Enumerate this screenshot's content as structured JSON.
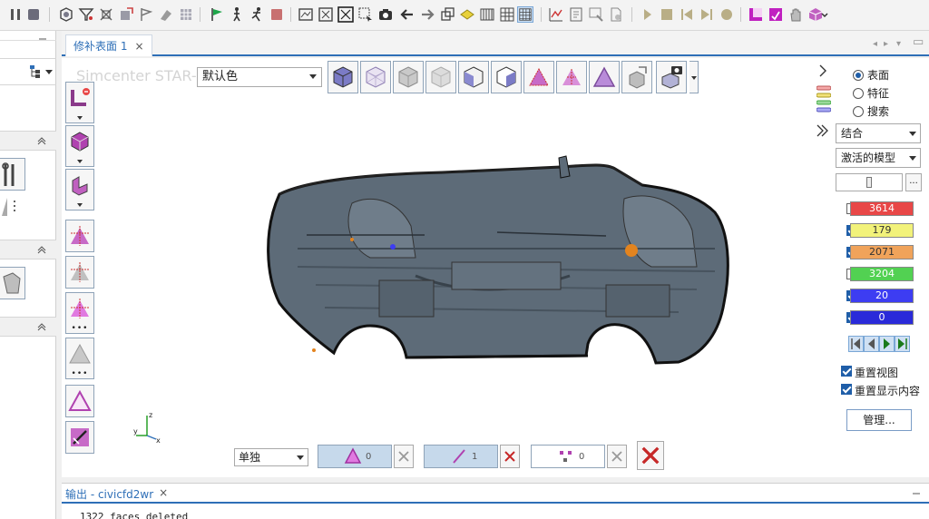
{
  "document_tab": {
    "label": "修补表面 1",
    "close": "×"
  },
  "viewport": {
    "watermark": "Simcenter STAR-CCM+",
    "color_mode": "默认色"
  },
  "bottom_bar": {
    "select_mode": "单独",
    "face_count": "0",
    "edge_count": "1",
    "vertex_count": "0"
  },
  "right_panel": {
    "radios": [
      {
        "label": "表面",
        "selected": true
      },
      {
        "label": "特征",
        "selected": false
      },
      {
        "label": "搜索",
        "selected": false
      }
    ],
    "combine_select": "结合",
    "model_select": "激活的模型",
    "slider_more": "...",
    "counts": [
      {
        "value": "3614",
        "checked": false,
        "color": "#e84747",
        "text_color": "#ffffff"
      },
      {
        "value": "179",
        "checked": true,
        "color": "#f2f27a",
        "text_color": "#333333"
      },
      {
        "value": "2071",
        "checked": true,
        "color": "#f0a35a",
        "text_color": "#333333"
      },
      {
        "value": "3204",
        "checked": false,
        "color": "#52d152",
        "text_color": "#ffffff"
      },
      {
        "value": "20",
        "checked": true,
        "color": "#3d3df2",
        "text_color": "#ffffff"
      },
      {
        "value": "0",
        "checked": true,
        "color": "#2a2ad9",
        "text_color": "#ffffff"
      }
    ],
    "reset_view": "重置视图",
    "reset_display": "重置显示内容",
    "manage_button": "管理..."
  },
  "output_panel": {
    "tab_label": "输出 - civicfd2wr",
    "close": "×",
    "text": "1322 faces deleted"
  },
  "colors": {
    "accent": "#2e6fb7",
    "mesh_body": "#5d6b78",
    "selection_magenta": "#cc33cc"
  },
  "icons": {
    "top_toolbar": [
      "pause-icon",
      "stop-icon",
      "mesh-icon",
      "filter-icon",
      "transform-icon",
      "surface-repair-icon",
      "flag-icon",
      "flag-icon",
      "grid-icon",
      "green-flag-icon",
      "walk-icon",
      "run-icon",
      "record-icon",
      "screenshot-icon",
      "fit-icon",
      "zoom-box-icon",
      "select-icon",
      "camera-icon",
      "arrow-left-icon",
      "arrow-right-icon",
      "view-icon",
      "highlight-icon",
      "columns-icon",
      "table-icon",
      "grid-toggle-icon",
      "plot-icon",
      "report-icon",
      "monitor-icon",
      "document-icon",
      "play-icon",
      "stop-icon",
      "step-back-icon",
      "step-forward-icon",
      "circle-icon",
      "select-magenta-icon",
      "select-magenta-icon",
      "hand-icon",
      "cube-icon"
    ]
  }
}
